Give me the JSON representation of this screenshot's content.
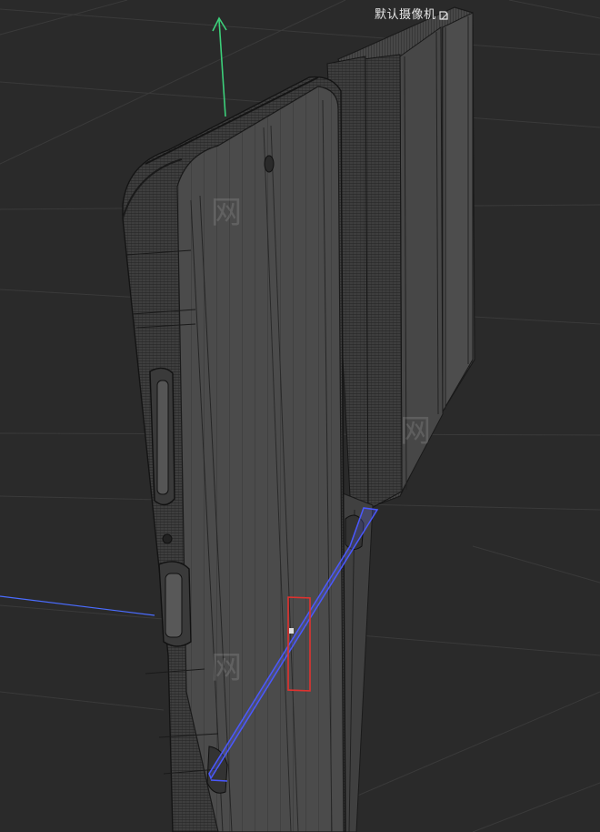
{
  "viewport": {
    "camera_label": "默认摄像机",
    "camera_icon": "camera-toggle-icon",
    "watermark_text": "网",
    "colors": {
      "background": "#2a2a2a",
      "grid_line": "#3a3a3a",
      "wire_dense": "#1a1a1a",
      "mesh_fill": "#4a4a4a",
      "axis_y": "#3ccf7a",
      "axis_x_blue": "#4a6cff",
      "selection_red": "#e0322f"
    }
  }
}
